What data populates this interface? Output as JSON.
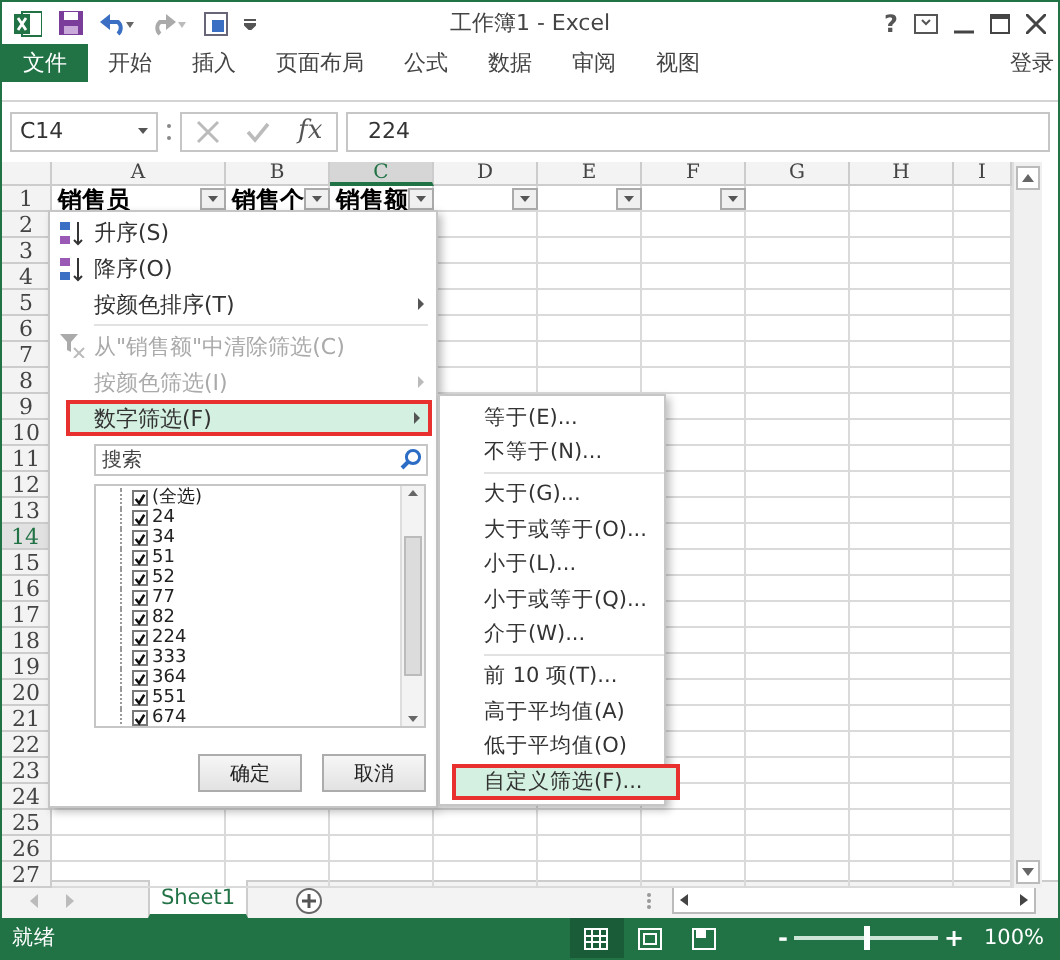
{
  "window": {
    "title": "工作簿1 - Excel",
    "help": "?"
  },
  "file_tab": "文件",
  "tabs": [
    {
      "label": "开始",
      "selected": false
    },
    {
      "label": "插入",
      "selected": false
    },
    {
      "label": "页面布局",
      "selected": false
    },
    {
      "label": "公式",
      "selected": false
    },
    {
      "label": "数据",
      "selected": false
    },
    {
      "label": "审阅",
      "selected": false
    },
    {
      "label": "视图",
      "selected": false
    }
  ],
  "sign_in": "登录",
  "formula_bar": {
    "name_box": "C14",
    "function_label": "fx",
    "value": "224"
  },
  "columns": [
    {
      "label": "A",
      "selected": false
    },
    {
      "label": "B",
      "selected": false
    },
    {
      "label": "C",
      "selected": true
    },
    {
      "label": "D",
      "selected": false
    },
    {
      "label": "E",
      "selected": false
    },
    {
      "label": "F",
      "selected": false
    },
    {
      "label": "G",
      "selected": false
    },
    {
      "label": "H",
      "selected": false
    },
    {
      "label": "I",
      "selected": false
    }
  ],
  "header_row": [
    {
      "text": "销售员",
      "filter": true
    },
    {
      "text": "销售个",
      "filter": true
    },
    {
      "text": "销售额",
      "filter": true
    },
    {
      "filter": true
    },
    {
      "filter": true
    },
    {
      "filter": true
    },
    {
      "filter": false
    },
    {
      "filter": false
    },
    {
      "filter": false
    }
  ],
  "rows": [
    {
      "label": "1",
      "selected": false
    },
    {
      "label": "2",
      "selected": false
    },
    {
      "label": "3",
      "selected": false
    },
    {
      "label": "4",
      "selected": false
    },
    {
      "label": "5",
      "selected": false
    },
    {
      "label": "6",
      "selected": false
    },
    {
      "label": "7",
      "selected": false
    },
    {
      "label": "8",
      "selected": false
    },
    {
      "label": "9",
      "selected": false
    },
    {
      "label": "10",
      "selected": false
    },
    {
      "label": "11",
      "selected": false
    },
    {
      "label": "12",
      "selected": false
    },
    {
      "label": "13",
      "selected": false
    },
    {
      "label": "14",
      "selected": true
    },
    {
      "label": "15",
      "selected": false
    },
    {
      "label": "16",
      "selected": false
    },
    {
      "label": "17",
      "selected": false
    },
    {
      "label": "18",
      "selected": false
    },
    {
      "label": "19",
      "selected": false
    },
    {
      "label": "20",
      "selected": false
    },
    {
      "label": "21",
      "selected": false
    },
    {
      "label": "22",
      "selected": false
    },
    {
      "label": "23",
      "selected": false
    },
    {
      "label": "24",
      "selected": false
    },
    {
      "label": "25",
      "selected": false
    },
    {
      "label": "26",
      "selected": false
    },
    {
      "label": "27",
      "selected": false
    }
  ],
  "filter_menu": {
    "items": [
      {
        "kind": "sort-asc",
        "label": "升序(S)",
        "disabled": false,
        "highlighted": false,
        "submenu": false
      },
      {
        "kind": "sort-desc",
        "label": "降序(O)",
        "disabled": false,
        "highlighted": false,
        "submenu": false
      },
      {
        "kind": "plain",
        "label": "按颜色排序(T)",
        "disabled": false,
        "highlighted": false,
        "submenu": true
      },
      {
        "kind": "separator"
      },
      {
        "kind": "clear-filter",
        "label": "从\"销售额\"中清除筛选(C)",
        "disabled": true,
        "highlighted": false,
        "submenu": false
      },
      {
        "kind": "plain",
        "label": "按颜色筛选(I)",
        "disabled": true,
        "highlighted": false,
        "submenu": true
      },
      {
        "kind": "plain",
        "label": "数字筛选(F)",
        "disabled": false,
        "highlighted": true,
        "submenu": true
      }
    ],
    "search": {
      "placeholder": "搜索"
    },
    "values": [
      {
        "label": "(全选)",
        "checked": true
      },
      {
        "label": "24",
        "checked": true
      },
      {
        "label": "34",
        "checked": true
      },
      {
        "label": "51",
        "checked": true
      },
      {
        "label": "52",
        "checked": true
      },
      {
        "label": "77",
        "checked": true
      },
      {
        "label": "82",
        "checked": true
      },
      {
        "label": "224",
        "checked": true
      },
      {
        "label": "333",
        "checked": true
      },
      {
        "label": "364",
        "checked": true
      },
      {
        "label": "551",
        "checked": true
      },
      {
        "label": "674",
        "checked": true
      }
    ],
    "buttons": [
      "确定",
      "取消"
    ]
  },
  "number_filter_menu": [
    {
      "kind": "item",
      "label": "等于(E)...",
      "highlighted": false
    },
    {
      "kind": "item",
      "label": "不等于(N)...",
      "highlighted": false
    },
    {
      "kind": "separator"
    },
    {
      "kind": "item",
      "label": "大于(G)...",
      "highlighted": false
    },
    {
      "kind": "item",
      "label": "大于或等于(O)...",
      "highlighted": false
    },
    {
      "kind": "item",
      "label": "小于(L)...",
      "highlighted": false
    },
    {
      "kind": "item",
      "label": "小于或等于(Q)...",
      "highlighted": false
    },
    {
      "kind": "item",
      "label": "介于(W)...",
      "highlighted": false
    },
    {
      "kind": "separator"
    },
    {
      "kind": "item",
      "label": "前 10 项(T)...",
      "highlighted": false
    },
    {
      "kind": "item",
      "label": "高于平均值(A)",
      "highlighted": false
    },
    {
      "kind": "item",
      "label": "低于平均值(O)",
      "highlighted": false
    },
    {
      "kind": "item",
      "label": "自定义筛选(F)...",
      "highlighted": true
    }
  ],
  "sheet_tabs": [
    {
      "label": "Sheet1",
      "selected": true
    }
  ],
  "status_bar": {
    "text": "就绪",
    "views": [
      {
        "kind": "normal",
        "selected": true
      },
      {
        "kind": "page-layout",
        "selected": false
      },
      {
        "kind": "page-break",
        "selected": false
      }
    ],
    "zoom_out": "-",
    "zoom_in": "+",
    "zoom": {
      "level": 0.5
    },
    "zoom_text": "100%"
  }
}
